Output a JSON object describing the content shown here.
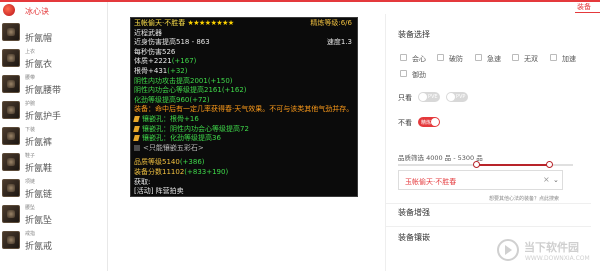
{
  "header": {
    "tab_label": "装备"
  },
  "sidebar": {
    "heading": "冰心诀",
    "items": [
      {
        "category": "",
        "name": "折氤帽",
        "icon": "hat-icon"
      },
      {
        "category": "上衣",
        "name": "折氤衣",
        "icon": "jacket-icon"
      },
      {
        "category": "腰带",
        "name": "折氤腰带",
        "icon": "belt-icon"
      },
      {
        "category": "护腕",
        "name": "折氤护手",
        "icon": "bracer-icon"
      },
      {
        "category": "下装",
        "name": "折氤裤",
        "icon": "pants-icon"
      },
      {
        "category": "鞋子",
        "name": "折氤鞋",
        "icon": "shoes-icon"
      },
      {
        "category": "项链",
        "name": "折氤链",
        "icon": "necklace-icon"
      },
      {
        "category": "腰坠",
        "name": "折氤坠",
        "icon": "pendant-icon"
      },
      {
        "category": "戒指",
        "name": "折氤戒",
        "icon": "ring-icon"
      }
    ]
  },
  "tooltip": {
    "name": "玉帐偷天·不胜春",
    "stars": "★★★★★★★★",
    "refine": "精炼等级:6/6",
    "type": "近程武器",
    "damage": "近身伤害提高518 - 863",
    "speed": "速度1.3",
    "dps": "每秒伤害526",
    "stat1_label": "体质+2221",
    "stat1_bonus": "(+167)",
    "stat2_label": "根骨+431",
    "stat2_bonus": "(+32)",
    "attr1": "阴性内功攻击提高2001(+150)",
    "attr2": "阴性内功会心等级提高2161(+162)",
    "attr3": "化劲等级提高960(+72)",
    "effect": "装备：命中后有一定几率获得春·天气效果。不可与该类其他气劲并存。",
    "socket1": "镶嵌孔：根骨+16",
    "socket2": "镶嵌孔：阴性内功会心等级提高72",
    "socket3": "镶嵌孔：化劲等级提高36",
    "socket4": "<只能镶嵌五彩石>",
    "quality_label": "品质等级5140",
    "quality_bonus": "(+386)",
    "score_label": "装备分数11102",
    "score_bonus": "(+833+190)",
    "acquire_label": "获取:",
    "acquire_value": "[活动] 阵营拍卖"
  },
  "panel": {
    "title": "装备选择",
    "checkboxes": [
      {
        "label": "会心"
      },
      {
        "label": "破防"
      },
      {
        "label": "急速"
      },
      {
        "label": "无双"
      },
      {
        "label": "加速"
      },
      {
        "label": "御劲"
      }
    ],
    "only_label": "只看",
    "toggle_pve": "PVE",
    "toggle_pvp": "PVP",
    "no_show_label": "不看",
    "toggle_refine": "精炼",
    "quality_range": "品质筛选 4000 品 - 5300 品",
    "slider": {
      "min": 4000,
      "max": 5300
    },
    "select_value": "玉帐偷天·不胜春",
    "helper": "想要其他心法的装备？点此搜索",
    "section_enchant": "装备增强",
    "section_inlay": "装备镶嵌"
  },
  "watermark": {
    "name": "当下软件园",
    "url": "WWW.DOWNXIA.COM"
  },
  "colors": {
    "accent": "#e4393c",
    "tooltip_bg": "#0b0b0b",
    "green": "#3fd94a",
    "orange": "#ff9c1a",
    "gold": "#f0c040"
  }
}
